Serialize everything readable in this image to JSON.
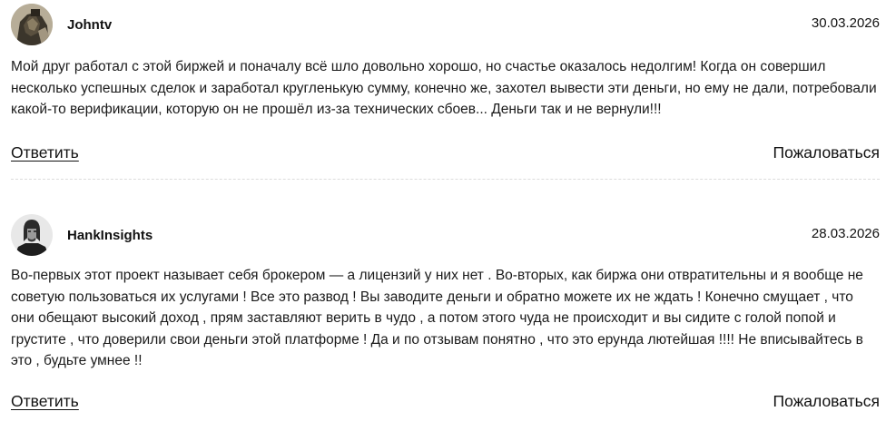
{
  "comments": [
    {
      "author": "Johntv",
      "date": "30.03.2026",
      "avatar_icon": "user-photo-icon",
      "text": "Мой друг работал с этой биржей и поначалу всё шло довольно хорошо, но счастье оказалось недолгим! Когда он совершил несколько успешных сделок и заработал кругленькую сумму, конечно же, захотел вывести эти деньги, но ему не дали, потребовали какой-то верификации, которую он не прошёл из-за технических сбоев... Деньги так и не вернули!!!",
      "reply_label": "Ответить",
      "report_label": "Пожаловаться"
    },
    {
      "author": "HankInsights",
      "date": "28.03.2026",
      "avatar_icon": "user-photo-icon",
      "text": "Во-первых этот проект называет себя брокером — а лицензий у них нет . Во-вторых, как биржа они отвратительны и я вообще не советую пользоваться их услугами ! Все это развод ! Вы заводите деньги и обратно можете их не ждать ! Конечно смущает , что они обещают высокий доход , прям заставляют верить в чудо , а потом этого чуда не происходит и вы сидите с голой попой и грустите , что доверили свои деньги этой платформе ! Да и по отзывам понятно , что это ерунда лютейшая !!!! Не вписывайтесь в это , будьте умнее !!",
      "reply_label": "Ответить",
      "report_label": "Пожаловаться"
    }
  ],
  "colors": {
    "text": "#1a1a1a",
    "divider": "#dcdcdc",
    "background": "#ffffff"
  }
}
